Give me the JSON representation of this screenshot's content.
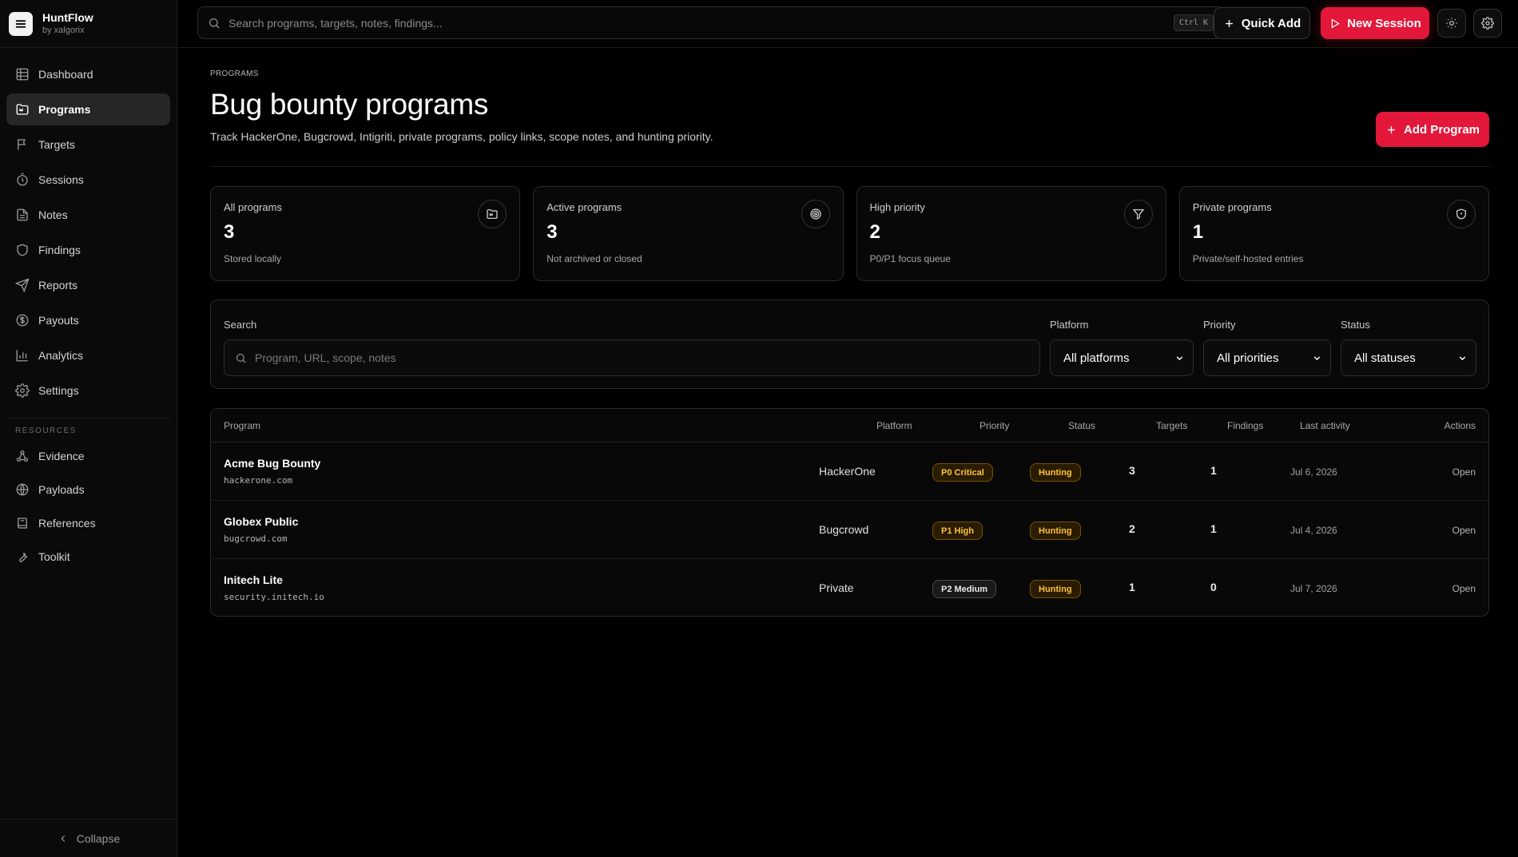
{
  "app": {
    "name": "HuntFlow",
    "byline": "by xalgorix"
  },
  "nav": [
    {
      "label": "Dashboard",
      "icon": "grid-icon"
    },
    {
      "label": "Programs",
      "icon": "folder-icon",
      "active": true
    },
    {
      "label": "Targets",
      "icon": "flag-icon"
    },
    {
      "label": "Sessions",
      "icon": "timer-icon"
    },
    {
      "label": "Notes",
      "icon": "file-text-icon"
    },
    {
      "label": "Findings",
      "icon": "shield-icon"
    },
    {
      "label": "Reports",
      "icon": "send-icon"
    },
    {
      "label": "Payouts",
      "icon": "dollar-icon"
    },
    {
      "label": "Analytics",
      "icon": "bar-chart-icon"
    },
    {
      "label": "Settings",
      "icon": "gear-icon"
    }
  ],
  "resources": {
    "label": "RESOURCES",
    "items": [
      {
        "label": "Evidence",
        "icon": "network-icon"
      },
      {
        "label": "Payloads",
        "icon": "globe-icon"
      },
      {
        "label": "References",
        "icon": "book-icon"
      },
      {
        "label": "Toolkit",
        "icon": "wrench-icon"
      }
    ]
  },
  "collapse_label": "Collapse",
  "topbar": {
    "search_placeholder": "Search programs, targets, notes, findings...",
    "shortcut": "Ctrl K",
    "quick_add": "Quick Add",
    "new_session": "New Session"
  },
  "page": {
    "breadcrumb": "PROGRAMS",
    "title": "Bug bounty programs",
    "subtitle": "Track HackerOne, Bugcrowd, Intigriti, private programs, policy links, scope notes, and hunting priority.",
    "add_button": "Add Program"
  },
  "stats": [
    {
      "label": "All programs",
      "value": "3",
      "note": "Stored locally",
      "icon": "folder-icon"
    },
    {
      "label": "Active programs",
      "value": "3",
      "note": "Not archived or closed",
      "icon": "target-icon"
    },
    {
      "label": "High priority",
      "value": "2",
      "note": "P0/P1 focus queue",
      "icon": "filter-icon"
    },
    {
      "label": "Private programs",
      "value": "1",
      "note": "Private/self-hosted entries",
      "icon": "shield-icon"
    }
  ],
  "filters": {
    "search_label": "Search",
    "search_placeholder": "Program, URL, scope, notes",
    "platform_label": "Platform",
    "platform_value": "All platforms",
    "priority_label": "Priority",
    "priority_value": "All priorities",
    "status_label": "Status",
    "status_value": "All statuses"
  },
  "table": {
    "columns": [
      "Program",
      "Platform",
      "Priority",
      "Status",
      "Targets",
      "Findings",
      "Last activity",
      "Actions"
    ],
    "rows": [
      {
        "name": "Acme Bug Bounty",
        "url": "hackerone.com",
        "platform": "HackerOne",
        "priority": "P0 Critical",
        "status": "Hunting",
        "targets": "3",
        "findings": "1",
        "last_activity": "Jul 6, 2026",
        "action": "Open"
      },
      {
        "name": "Globex Public",
        "url": "bugcrowd.com",
        "platform": "Bugcrowd",
        "priority": "P1 High",
        "status": "Hunting",
        "targets": "2",
        "findings": "1",
        "last_activity": "Jul 4, 2026",
        "action": "Open"
      },
      {
        "name": "Initech Lite",
        "url": "security.initech.io",
        "platform": "Private",
        "priority": "P2 Medium",
        "status": "Hunting",
        "targets": "1",
        "findings": "0",
        "last_activity": "Jul 7, 2026",
        "action": "Open"
      }
    ]
  },
  "colors": {
    "accent": "#e2173a",
    "badge_warning": "#ffc23d",
    "background": "#000000"
  }
}
